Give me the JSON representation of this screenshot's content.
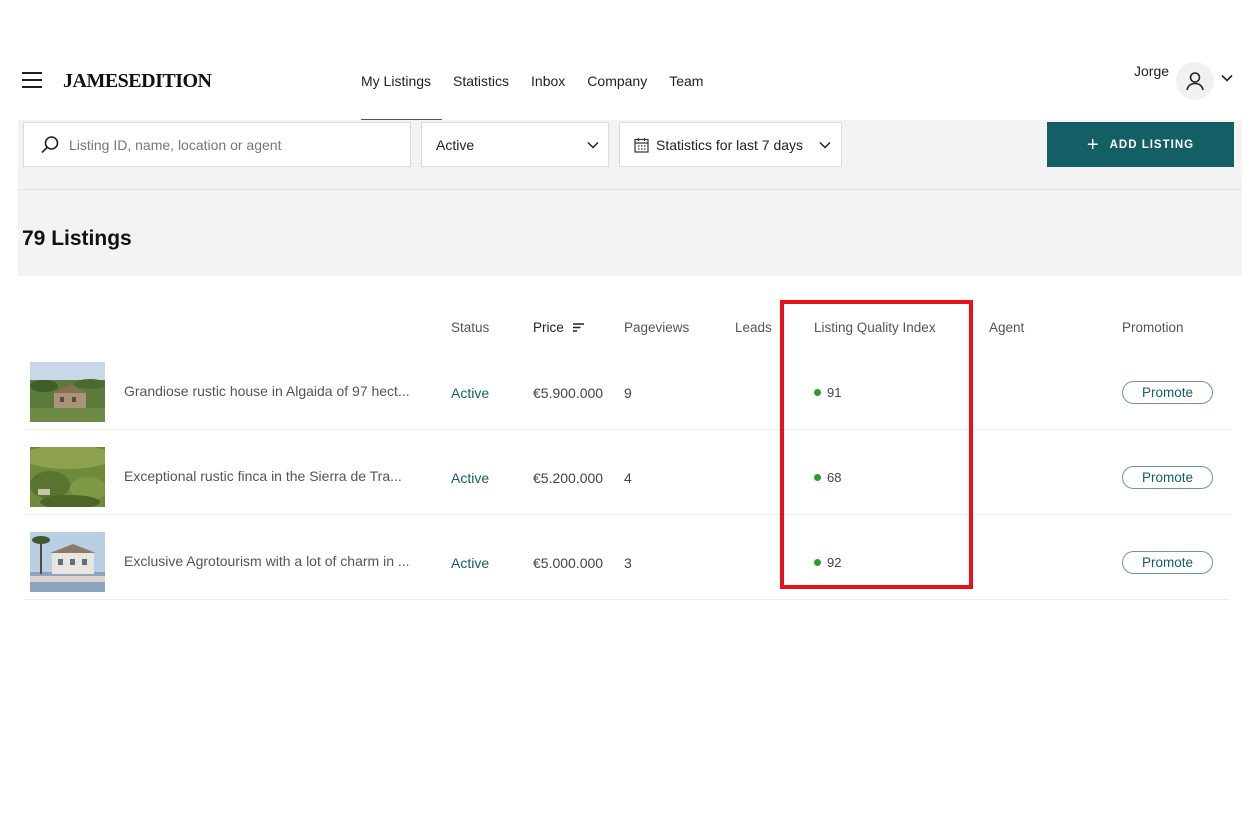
{
  "header": {
    "logo": "JAMESEDITION",
    "nav": [
      "My Listings",
      "Statistics",
      "Inbox",
      "Company",
      "Team"
    ],
    "user_name": "Jorge"
  },
  "filters": {
    "search_placeholder": "Listing ID, name, location or agent",
    "status_value": "Active",
    "stats_value": "Statistics for last 7 days",
    "add_label": "ADD LISTING"
  },
  "count_title": "79 Listings",
  "table": {
    "headers": {
      "status": "Status",
      "price": "Price",
      "pageviews": "Pageviews",
      "leads": "Leads",
      "lqi": "Listing Quality Index",
      "agent": "Agent",
      "promotion": "Promotion"
    },
    "rows": [
      {
        "name": "Grandiose rustic house in Algaida of 97 hect...",
        "status": "Active",
        "price": "€5.900.000",
        "pageviews": "9",
        "lqi": "91",
        "promote": "Promote"
      },
      {
        "name": "Exceptional rustic finca in the Sierra de Tra...",
        "status": "Active",
        "price": "€5.200.000",
        "pageviews": "4",
        "lqi": "68",
        "promote": "Promote"
      },
      {
        "name": "Exclusive Agrotourism with a lot of charm in ...",
        "status": "Active",
        "price": "€5.000.000",
        "pageviews": "3",
        "lqi": "92",
        "promote": "Promote"
      }
    ]
  },
  "colors": {
    "accent": "#145f66",
    "quality_dot": "#2f9a2f",
    "highlight": "#e8101a"
  }
}
